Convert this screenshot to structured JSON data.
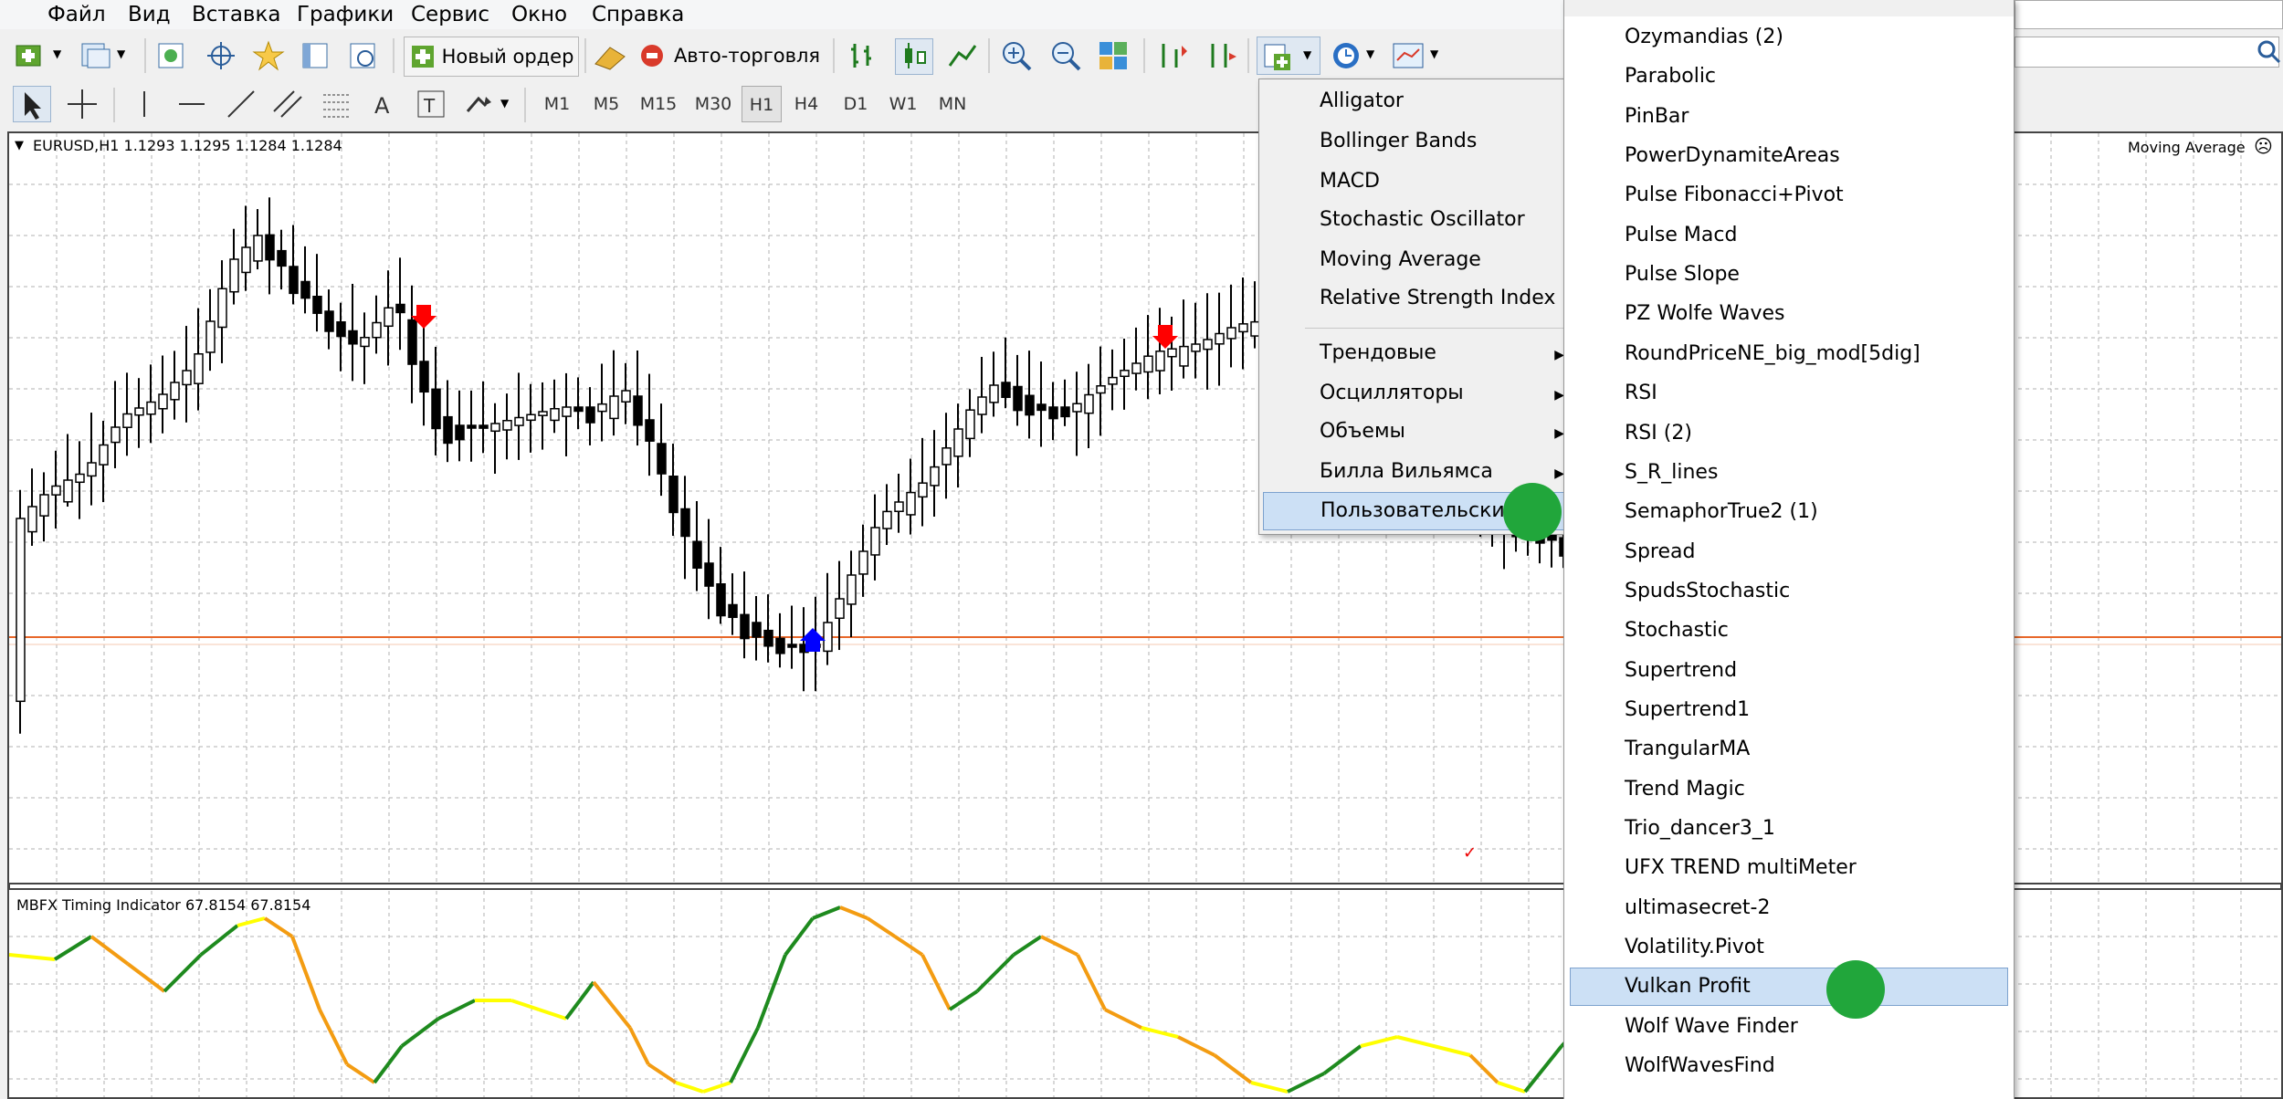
{
  "menubar": {
    "items": [
      "Файл",
      "Вид",
      "Вставка",
      "Графики",
      "Сервис",
      "Окно",
      "Справка"
    ]
  },
  "toolbar": {
    "new_order_label": "Новый ордер",
    "autotrading_label": "Авто-торговля"
  },
  "timeframes": [
    "M1",
    "M5",
    "M15",
    "M30",
    "H1",
    "H4",
    "D1",
    "W1",
    "MN"
  ],
  "active_timeframe": "H1",
  "chart": {
    "symbol_info": "EURUSD,H1  1.1293 1.1295 1.1284 1.1284",
    "indicator_label": "Moving Average",
    "subwindow_label": "MBFX Timing Indicator 67.8154 67.8154",
    "level_line_color": "#e8682a"
  },
  "indicators_menu": {
    "items": [
      "Alligator",
      "Bollinger Bands",
      "MACD",
      "Stochastic Oscillator",
      "Moving Average",
      "Relative Strength Index"
    ],
    "submenus": [
      "Трендовые",
      "Осцилляторы",
      "Объемы",
      "Билла Вильямса"
    ],
    "highlighted": "Пользовательский"
  },
  "custom_menu": {
    "items": [
      "Ozymandias (2)",
      "Parabolic",
      "PinBar",
      "PowerDynamiteAreas",
      "Pulse Fibonacci+Pivot",
      "Pulse Macd",
      "Pulse Slope",
      "PZ Wolfe Waves",
      "RoundPriceNE_big_mod[5dig]",
      "RSI",
      "RSI (2)",
      "S_R_lines",
      "SemaphorTrue2 (1)",
      "Spread",
      "SpudsStochastic",
      "Stochastic",
      "Supertrend",
      "Supertrend1",
      "TrangularMA",
      "Trend Magic",
      "Trio_dancer3_1",
      "UFX TREND multiMeter",
      "ultimasecret-2",
      "Volatility.Pivot",
      "Vulkan Profit",
      "Wolf Wave Finder",
      "WolfWavesFind"
    ],
    "highlighted": "Vulkan Profit"
  },
  "colors": {
    "highlight": "#cce0f5",
    "marker_green": "#21a63b",
    "arrow_down": "#ff0000",
    "arrow_up": "#0000ff",
    "osc_orange": "#f39c12",
    "osc_yellow": "#ffff00",
    "osc_green": "#1e8a1e"
  }
}
